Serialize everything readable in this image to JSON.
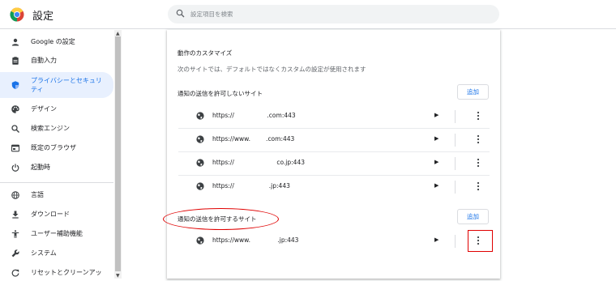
{
  "header": {
    "title": "設定",
    "search_placeholder": "設定項目を検索"
  },
  "sidebar": {
    "items": [
      {
        "label": "Google の設定",
        "icon": "person-icon"
      },
      {
        "label": "自動入力",
        "icon": "clipboard-icon"
      },
      {
        "label": "プライバシーとセキュリ\nティ",
        "icon": "shield-icon",
        "active": true
      },
      {
        "label": "デザイン",
        "icon": "palette-icon"
      },
      {
        "label": "検索エンジン",
        "icon": "search-icon"
      },
      {
        "label": "既定のブラウザ",
        "icon": "browser-icon"
      },
      {
        "label": "起動時",
        "icon": "power-icon"
      },
      {
        "label": "言語",
        "icon": "globe-icon"
      },
      {
        "label": "ダウンロード",
        "icon": "download-icon"
      },
      {
        "label": "ユーザー補助機能",
        "icon": "accessibility-icon"
      },
      {
        "label": "システム",
        "icon": "wrench-icon"
      },
      {
        "label": "リセットとクリーンアッ",
        "icon": "reset-icon"
      }
    ]
  },
  "main": {
    "custom_heading": "動作のカスタマイズ",
    "custom_desc": "次のサイトでは、デフォルトではなくカスタムの設定が使用されます",
    "blocked": {
      "label": "通知の送信を許可しないサイト",
      "add_label": "追加",
      "sites": [
        "https://                 .com:443",
        "https://www.        .com:443",
        "https://                      co.jp:443",
        "https://                  .jp:443"
      ]
    },
    "allowed": {
      "label": "通知の送信を許可するサイト",
      "add_label": "追加",
      "sites": [
        "https://www.              .jp:443"
      ]
    }
  },
  "colors": {
    "accent": "#1a73e8",
    "active_bg": "#e8f0fe",
    "highlight": "#e00000"
  }
}
